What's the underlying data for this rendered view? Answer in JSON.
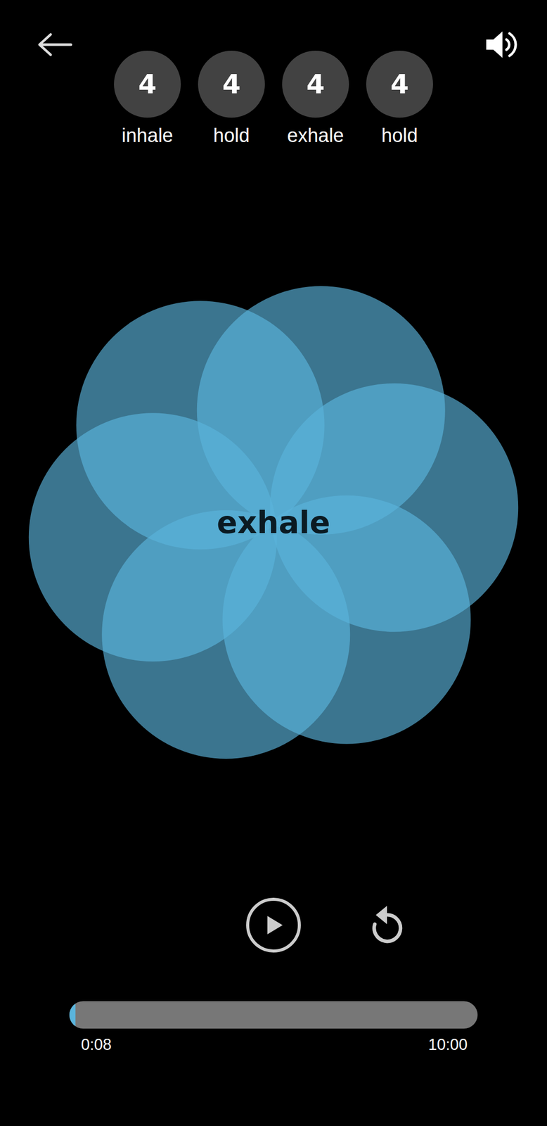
{
  "steps": [
    {
      "count": "4",
      "label": "inhale"
    },
    {
      "count": "4",
      "label": "hold"
    },
    {
      "count": "4",
      "label": "exhale"
    },
    {
      "count": "4",
      "label": "hold"
    }
  ],
  "sound": {
    "muted": false
  },
  "phase": "exhale",
  "player": {
    "playing": false
  },
  "progress": {
    "level": 0.013,
    "elapsed": "0:08",
    "total": "10:00"
  }
}
